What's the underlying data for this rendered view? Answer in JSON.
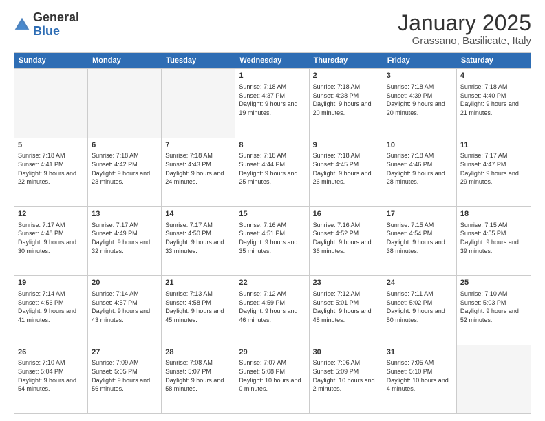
{
  "header": {
    "logo_general": "General",
    "logo_blue": "Blue",
    "month_title": "January 2025",
    "subtitle": "Grassano, Basilicate, Italy"
  },
  "days_of_week": [
    "Sunday",
    "Monday",
    "Tuesday",
    "Wednesday",
    "Thursday",
    "Friday",
    "Saturday"
  ],
  "weeks": [
    [
      {
        "day": "",
        "empty": true
      },
      {
        "day": "",
        "empty": true
      },
      {
        "day": "",
        "empty": true
      },
      {
        "day": "1",
        "sunrise": "Sunrise: 7:18 AM",
        "sunset": "Sunset: 4:37 PM",
        "daylight": "Daylight: 9 hours and 19 minutes."
      },
      {
        "day": "2",
        "sunrise": "Sunrise: 7:18 AM",
        "sunset": "Sunset: 4:38 PM",
        "daylight": "Daylight: 9 hours and 20 minutes."
      },
      {
        "day": "3",
        "sunrise": "Sunrise: 7:18 AM",
        "sunset": "Sunset: 4:39 PM",
        "daylight": "Daylight: 9 hours and 20 minutes."
      },
      {
        "day": "4",
        "sunrise": "Sunrise: 7:18 AM",
        "sunset": "Sunset: 4:40 PM",
        "daylight": "Daylight: 9 hours and 21 minutes."
      }
    ],
    [
      {
        "day": "5",
        "sunrise": "Sunrise: 7:18 AM",
        "sunset": "Sunset: 4:41 PM",
        "daylight": "Daylight: 9 hours and 22 minutes."
      },
      {
        "day": "6",
        "sunrise": "Sunrise: 7:18 AM",
        "sunset": "Sunset: 4:42 PM",
        "daylight": "Daylight: 9 hours and 23 minutes."
      },
      {
        "day": "7",
        "sunrise": "Sunrise: 7:18 AM",
        "sunset": "Sunset: 4:43 PM",
        "daylight": "Daylight: 9 hours and 24 minutes."
      },
      {
        "day": "8",
        "sunrise": "Sunrise: 7:18 AM",
        "sunset": "Sunset: 4:44 PM",
        "daylight": "Daylight: 9 hours and 25 minutes."
      },
      {
        "day": "9",
        "sunrise": "Sunrise: 7:18 AM",
        "sunset": "Sunset: 4:45 PM",
        "daylight": "Daylight: 9 hours and 26 minutes."
      },
      {
        "day": "10",
        "sunrise": "Sunrise: 7:18 AM",
        "sunset": "Sunset: 4:46 PM",
        "daylight": "Daylight: 9 hours and 28 minutes."
      },
      {
        "day": "11",
        "sunrise": "Sunrise: 7:17 AM",
        "sunset": "Sunset: 4:47 PM",
        "daylight": "Daylight: 9 hours and 29 minutes."
      }
    ],
    [
      {
        "day": "12",
        "sunrise": "Sunrise: 7:17 AM",
        "sunset": "Sunset: 4:48 PM",
        "daylight": "Daylight: 9 hours and 30 minutes."
      },
      {
        "day": "13",
        "sunrise": "Sunrise: 7:17 AM",
        "sunset": "Sunset: 4:49 PM",
        "daylight": "Daylight: 9 hours and 32 minutes."
      },
      {
        "day": "14",
        "sunrise": "Sunrise: 7:17 AM",
        "sunset": "Sunset: 4:50 PM",
        "daylight": "Daylight: 9 hours and 33 minutes."
      },
      {
        "day": "15",
        "sunrise": "Sunrise: 7:16 AM",
        "sunset": "Sunset: 4:51 PM",
        "daylight": "Daylight: 9 hours and 35 minutes."
      },
      {
        "day": "16",
        "sunrise": "Sunrise: 7:16 AM",
        "sunset": "Sunset: 4:52 PM",
        "daylight": "Daylight: 9 hours and 36 minutes."
      },
      {
        "day": "17",
        "sunrise": "Sunrise: 7:15 AM",
        "sunset": "Sunset: 4:54 PM",
        "daylight": "Daylight: 9 hours and 38 minutes."
      },
      {
        "day": "18",
        "sunrise": "Sunrise: 7:15 AM",
        "sunset": "Sunset: 4:55 PM",
        "daylight": "Daylight: 9 hours and 39 minutes."
      }
    ],
    [
      {
        "day": "19",
        "sunrise": "Sunrise: 7:14 AM",
        "sunset": "Sunset: 4:56 PM",
        "daylight": "Daylight: 9 hours and 41 minutes."
      },
      {
        "day": "20",
        "sunrise": "Sunrise: 7:14 AM",
        "sunset": "Sunset: 4:57 PM",
        "daylight": "Daylight: 9 hours and 43 minutes."
      },
      {
        "day": "21",
        "sunrise": "Sunrise: 7:13 AM",
        "sunset": "Sunset: 4:58 PM",
        "daylight": "Daylight: 9 hours and 45 minutes."
      },
      {
        "day": "22",
        "sunrise": "Sunrise: 7:12 AM",
        "sunset": "Sunset: 4:59 PM",
        "daylight": "Daylight: 9 hours and 46 minutes."
      },
      {
        "day": "23",
        "sunrise": "Sunrise: 7:12 AM",
        "sunset": "Sunset: 5:01 PM",
        "daylight": "Daylight: 9 hours and 48 minutes."
      },
      {
        "day": "24",
        "sunrise": "Sunrise: 7:11 AM",
        "sunset": "Sunset: 5:02 PM",
        "daylight": "Daylight: 9 hours and 50 minutes."
      },
      {
        "day": "25",
        "sunrise": "Sunrise: 7:10 AM",
        "sunset": "Sunset: 5:03 PM",
        "daylight": "Daylight: 9 hours and 52 minutes."
      }
    ],
    [
      {
        "day": "26",
        "sunrise": "Sunrise: 7:10 AM",
        "sunset": "Sunset: 5:04 PM",
        "daylight": "Daylight: 9 hours and 54 minutes."
      },
      {
        "day": "27",
        "sunrise": "Sunrise: 7:09 AM",
        "sunset": "Sunset: 5:05 PM",
        "daylight": "Daylight: 9 hours and 56 minutes."
      },
      {
        "day": "28",
        "sunrise": "Sunrise: 7:08 AM",
        "sunset": "Sunset: 5:07 PM",
        "daylight": "Daylight: 9 hours and 58 minutes."
      },
      {
        "day": "29",
        "sunrise": "Sunrise: 7:07 AM",
        "sunset": "Sunset: 5:08 PM",
        "daylight": "Daylight: 10 hours and 0 minutes."
      },
      {
        "day": "30",
        "sunrise": "Sunrise: 7:06 AM",
        "sunset": "Sunset: 5:09 PM",
        "daylight": "Daylight: 10 hours and 2 minutes."
      },
      {
        "day": "31",
        "sunrise": "Sunrise: 7:05 AM",
        "sunset": "Sunset: 5:10 PM",
        "daylight": "Daylight: 10 hours and 4 minutes."
      },
      {
        "day": "",
        "empty": true
      }
    ]
  ]
}
